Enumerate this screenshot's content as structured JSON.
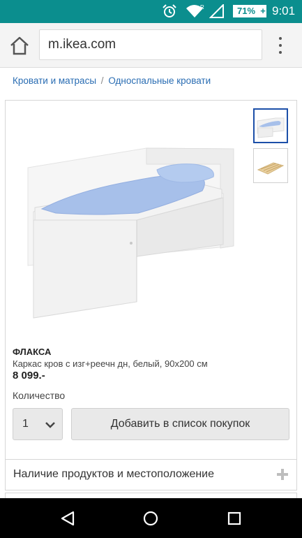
{
  "status_bar": {
    "battery": "71%",
    "charging_mark": "+",
    "time": "9:01",
    "icons": [
      "alarm-icon",
      "wifi-icon",
      "signal-icon",
      "battery-icon"
    ],
    "roaming_mark": "R"
  },
  "browser": {
    "url": "m.ikea.com",
    "icons": [
      "home-icon",
      "overflow-menu-icon"
    ]
  },
  "breadcrumb": {
    "items": [
      "Кровати и матрасы",
      "Односпальные кровати"
    ],
    "separator": "/"
  },
  "product": {
    "name": "ФЛАКСА",
    "description": "Каркас кров с изг+реечн дн, белый, 90x200 см",
    "price": "8 099.-",
    "quantity_label": "Количество",
    "quantity_value": "1",
    "add_button_label": "Добавить в список покупок",
    "thumbnails": [
      "bed-frame-thumbnail",
      "slatted-base-thumbnail"
    ]
  },
  "availability": {
    "label": "Наличие продуктов и местоположение"
  },
  "colors": {
    "status_bar": "#0b8e8e",
    "link": "#2a6db3",
    "selected_thumb_border": "#1c4fa8"
  }
}
